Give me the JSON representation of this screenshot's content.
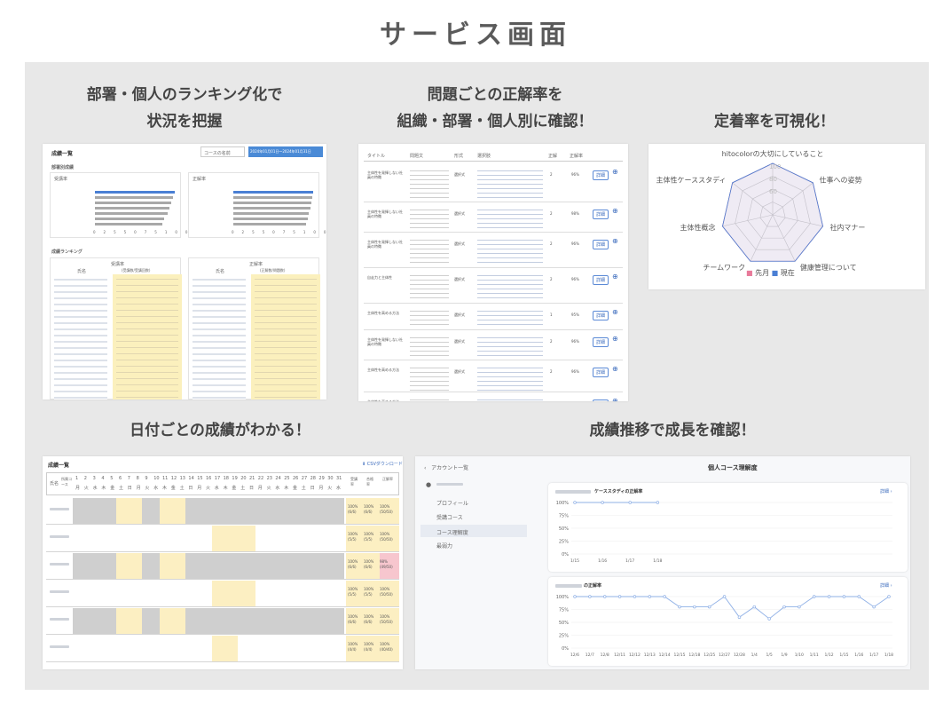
{
  "page_title": "サービス画面",
  "captions": {
    "c1_l1": "部署・個人のランキング化で",
    "c1_l2": "状況を把握",
    "c2_l1": "問題ごとの正解率を",
    "c2_l2": "組織・部署・個人別に確認！",
    "c3": "定着率を可視化！",
    "c4": "日付ごとの成績がわかる！",
    "c5": "成績推移で成長を確認！"
  },
  "s1": {
    "heading": "成績一覧",
    "search_placeholder": "コースの名前",
    "date_range": "2024年01月01日〜2024年01月31日",
    "section_title": "部署別成績",
    "chart1_title": "受講率",
    "chart2_title": "正解率",
    "axis_ticks": [
      "0",
      "25",
      "50",
      "75",
      "100"
    ],
    "ranking_title": "成績ランキング",
    "table1_head": "受講率",
    "table1_cols": [
      "氏名",
      "(受講数/受講回数)"
    ],
    "table2_head": "正解率",
    "table2_cols": [
      "氏名",
      "(正解数/問題数)"
    ]
  },
  "s2": {
    "headers": [
      "タイトル",
      "問題文",
      "形式",
      "選択肢",
      "正解",
      "正解率",
      ""
    ],
    "detail_label": "詳細",
    "rows": [
      {
        "title": "主体性を発揮しない社員の特徴",
        "type": "選択式",
        "ans": "2",
        "rate": "96%"
      },
      {
        "title": "主体性を発揮しない社員の特徴",
        "type": "選択式",
        "ans": "2",
        "rate": "98%"
      },
      {
        "title": "主体性を発揮しない社員の特徴",
        "type": "選択式",
        "ans": "2",
        "rate": "96%"
      },
      {
        "title": "自走力と主体性",
        "type": "選択式",
        "ans": "2",
        "rate": "96%"
      },
      {
        "title": "主体性を高める方法",
        "type": "選択式",
        "ans": "1",
        "rate": "95%"
      },
      {
        "title": "主体性を発揮しない社員の特徴",
        "type": "選択式",
        "ans": "2",
        "rate": "96%"
      },
      {
        "title": "主体性を高める方法",
        "type": "選択式",
        "ans": "2",
        "rate": "96%"
      },
      {
        "title": "主体性を高める方法",
        "type": "選択式",
        "ans": "2",
        "rate": "97%"
      }
    ]
  },
  "s3": {
    "labels": [
      "hitocolorの大切にしていること",
      "仕事への姿勢",
      "社内マナー",
      "健康管理について",
      "チームワーク",
      "主体性概念",
      "主体性ケーススタディ"
    ],
    "ticks": [
      "100",
      "80",
      "60"
    ],
    "legend": [
      "先月",
      "現在"
    ],
    "colors": {
      "prev": "#e87a9a",
      "now": "#4a7fd4"
    },
    "series": [
      {
        "name": "先月",
        "values": [
          100,
          100,
          100,
          100,
          100,
          100,
          100
        ]
      },
      {
        "name": "現在",
        "values": [
          100,
          100,
          100,
          100,
          100,
          100,
          100
        ]
      }
    ]
  },
  "s4": {
    "heading": "成績一覧",
    "download": "CSVダウンロード",
    "col_name": "氏名",
    "col_dept": "所属コース",
    "days": [
      "1",
      "2",
      "3",
      "4",
      "5",
      "6",
      "7",
      "8",
      "9",
      "10",
      "11",
      "12",
      "13",
      "14",
      "15",
      "16",
      "17",
      "18",
      "19",
      "20",
      "21",
      "22",
      "23",
      "24",
      "25",
      "26",
      "27",
      "28",
      "29",
      "30",
      "31"
    ],
    "weekdays": [
      "月",
      "火",
      "水",
      "木",
      "金",
      "土",
      "日",
      "月",
      "火",
      "水",
      "木",
      "金",
      "土",
      "日",
      "月",
      "火",
      "水",
      "木",
      "金",
      "土",
      "日",
      "月",
      "火",
      "水",
      "木",
      "金",
      "土",
      "日",
      "月",
      "火",
      "水"
    ],
    "stat_cols": [
      "受講率",
      "合格率",
      "正解率"
    ],
    "rows": [
      {
        "a": "100%",
        "a2": "(6/6)",
        "b": "100%",
        "b2": "(6/6)",
        "c": "100%",
        "c2": "(50/50)"
      },
      {
        "a": "100%",
        "a2": "(5/5)",
        "b": "100%",
        "b2": "(5/5)",
        "c": "100%",
        "c2": "(50/50)"
      },
      {
        "a": "100%",
        "a2": "(6/6)",
        "b": "100%",
        "b2": "(6/6)",
        "c": "98%",
        "c2": "(49/50)"
      },
      {
        "a": "100%",
        "a2": "(5/5)",
        "b": "100%",
        "b2": "(5/5)",
        "c": "100%",
        "c2": "(50/50)"
      },
      {
        "a": "100%",
        "a2": "(6/6)",
        "b": "100%",
        "b2": "(6/6)",
        "c": "100%",
        "c2": "(50/50)"
      },
      {
        "a": "100%",
        "a2": "(4/4)",
        "b": "100%",
        "b2": "(4/4)",
        "c": "100%",
        "c2": "(40/40)"
      }
    ]
  },
  "s5": {
    "back": "アカウント一覧",
    "page_title": "個人コース理解度",
    "menu": [
      "プロフィール",
      "受講コース",
      "コース理解度",
      "最弱力"
    ],
    "card1_title": "ケーススタディの正解率",
    "card2_title": "の正解率",
    "detail": "詳細 ›",
    "y_ticks": [
      "100%",
      "75%",
      "50%",
      "25%",
      "0%"
    ],
    "chart_data": [
      {
        "type": "line",
        "x": [
          "1/15",
          "1/16",
          "1/17",
          "1/18"
        ],
        "series": [
          {
            "values": [
              100,
              100,
              100,
              100
            ]
          }
        ],
        "ylim": [
          0,
          100
        ]
      },
      {
        "type": "line",
        "x": [
          "12/6",
          "12/7",
          "12/8",
          "12/11",
          "12/12",
          "12/13",
          "12/14",
          "12/15",
          "12/18",
          "12/25",
          "12/27",
          "12/28",
          "1/4",
          "1/5",
          "1/9",
          "1/10",
          "1/11",
          "1/12",
          "1/15",
          "1/16",
          "1/17",
          "1/18"
        ],
        "series": [
          {
            "values": [
              100,
              100,
              100,
              100,
              100,
              100,
              100,
              80,
              80,
              80,
              100,
              60,
              80,
              57,
              80,
              80,
              100,
              100,
              100,
              100,
              80,
              100
            ]
          }
        ],
        "ylim": [
          0,
          100
        ]
      }
    ]
  }
}
